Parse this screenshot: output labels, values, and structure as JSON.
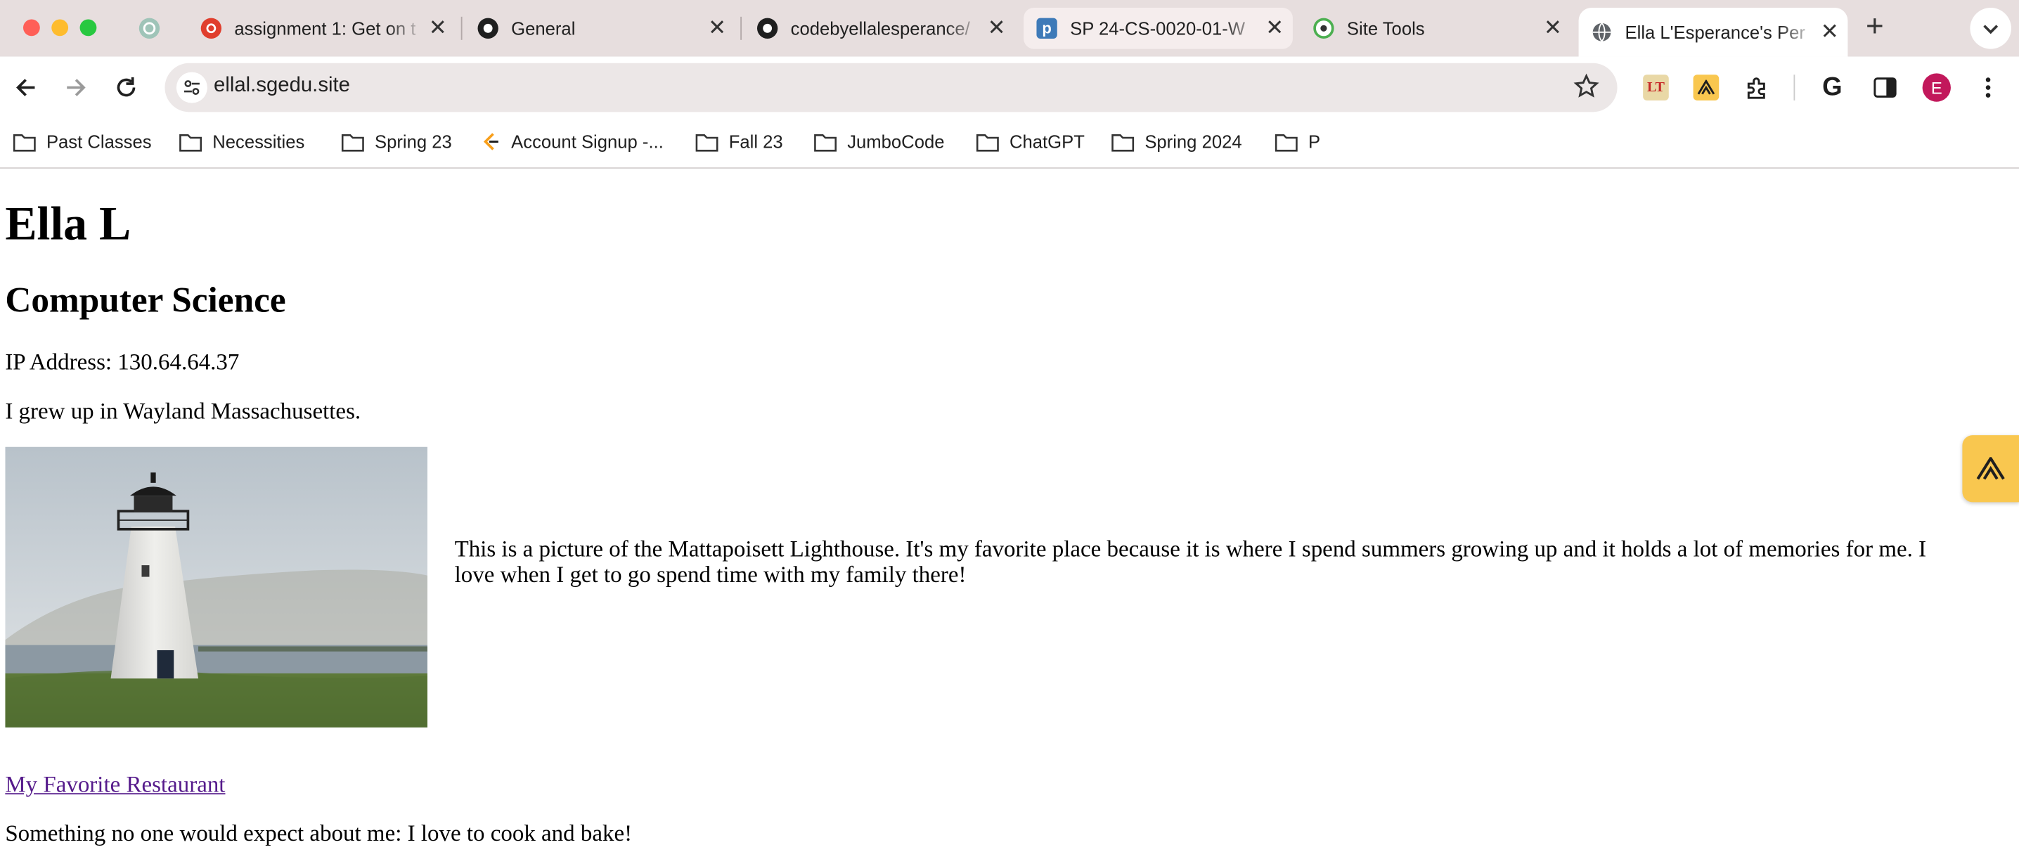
{
  "browser": {
    "tabs": [
      {
        "title": "",
        "icon": "chatgpt-icon"
      },
      {
        "title": "assignment 1: Get on t",
        "icon": "canvas-icon"
      },
      {
        "title": "General",
        "icon": "github-icon"
      },
      {
        "title": "codebyellalesperance/",
        "icon": "github-icon"
      },
      {
        "title": "SP 24-CS-0020-01-W",
        "icon": "piazza-icon"
      },
      {
        "title": "Site Tools",
        "icon": "siteground-icon"
      },
      {
        "title": "Ella L'Esperance's Per",
        "icon": "globe-icon"
      }
    ],
    "new_tab": "+",
    "address": "ellal.sgedu.site",
    "profile_initial": "E",
    "bookmarks": [
      {
        "label": "Past Classes",
        "icon": "folder-icon"
      },
      {
        "label": "Necessities",
        "icon": "folder-icon"
      },
      {
        "label": "Spring 23",
        "icon": "folder-icon"
      },
      {
        "label": "Account Signup -...",
        "icon": "leetcode-icon"
      },
      {
        "label": "Fall 23",
        "icon": "folder-icon"
      },
      {
        "label": "JumboCode",
        "icon": "folder-icon"
      },
      {
        "label": "ChatGPT",
        "icon": "folder-icon"
      },
      {
        "label": "Spring 2024",
        "icon": "folder-icon"
      },
      {
        "label": "P",
        "icon": "folder-icon"
      }
    ],
    "colors": {
      "tabstrip": "#e7dede",
      "omnibox": "#ece7e7",
      "profile": "#c2185b",
      "ext_yellow": "#f9c74f"
    }
  },
  "page": {
    "name": "Ella L",
    "major": "Computer Science",
    "ip_line": "IP Address: 130.64.64.37",
    "hometown": "I grew up in Wayland Massachusettes.",
    "caption": "This is a picture of the Mattapoisett Lighthouse. It's my favorite place because it is where I spend summers growing up and it holds a lot of memories for me. I love when I get to go spend time with my family there!",
    "link_text": "My Favorite Restaurant",
    "fun_fact": "Something no one would expect about me: I love to cook and bake!",
    "colors": {
      "link": "#551a8b"
    }
  }
}
